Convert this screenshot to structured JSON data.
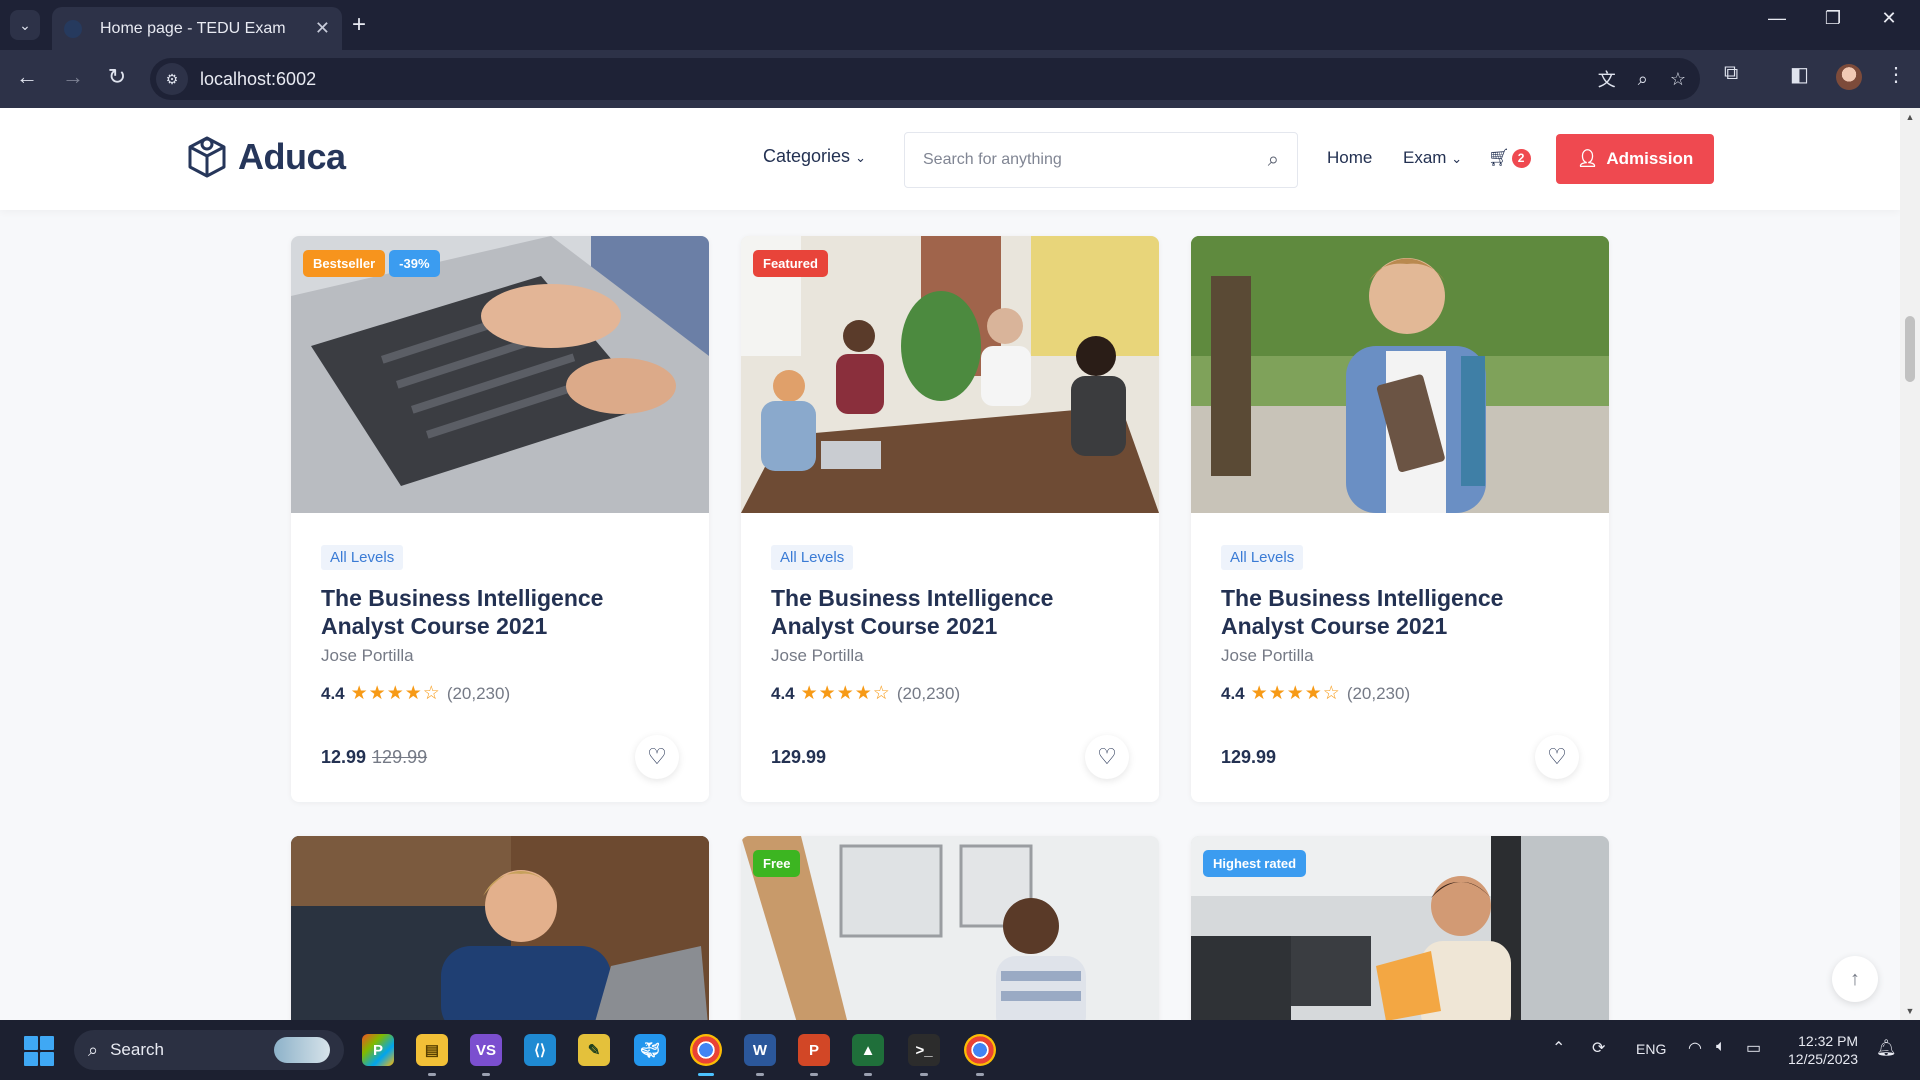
{
  "browser": {
    "tab_title": "Home page - TEDU Exam",
    "url": "localhost:6002"
  },
  "header": {
    "logo_text": "Aduca",
    "categories_label": "Categories",
    "search_placeholder": "Search for anything",
    "nav_home": "Home",
    "nav_exam": "Exam",
    "cart_count": "2",
    "admission_label": "Admission",
    "accent_color": "#ef4950"
  },
  "courses": [
    {
      "badges": [
        "Bestseller",
        "-39%"
      ],
      "level": "All Levels",
      "title": "The Business Intelligence Analyst Course 2021",
      "author": "Jose Portilla",
      "rating": "4.4",
      "stars": "★★★★☆",
      "rating_count": "(20,230)",
      "price": "12.99",
      "old_price": "129.99"
    },
    {
      "badges": [
        "Featured"
      ],
      "level": "All Levels",
      "title": "The Business Intelligence Analyst Course 2021",
      "author": "Jose Portilla",
      "rating": "4.4",
      "stars": "★★★★☆",
      "rating_count": "(20,230)",
      "price": "129.99",
      "old_price": ""
    },
    {
      "badges": [],
      "level": "All Levels",
      "title": "The Business Intelligence Analyst Course 2021",
      "author": "Jose Portilla",
      "rating": "4.4",
      "stars": "★★★★☆",
      "rating_count": "(20,230)",
      "price": "129.99",
      "old_price": ""
    },
    {
      "badges": []
    },
    {
      "badges": [
        "Free"
      ]
    },
    {
      "badges": [
        "Highest rated"
      ]
    }
  ],
  "badge_colors": {
    "Bestseller": "#f7941d",
    "-39%": "#3b9cf0",
    "Featured": "#e8443a",
    "Free": "#3cb521",
    "Highest rated": "#3b9cf0"
  },
  "taskbar": {
    "search_label": "Search",
    "language": "ENG",
    "time": "12:32 PM",
    "date": "12/25/2023"
  }
}
